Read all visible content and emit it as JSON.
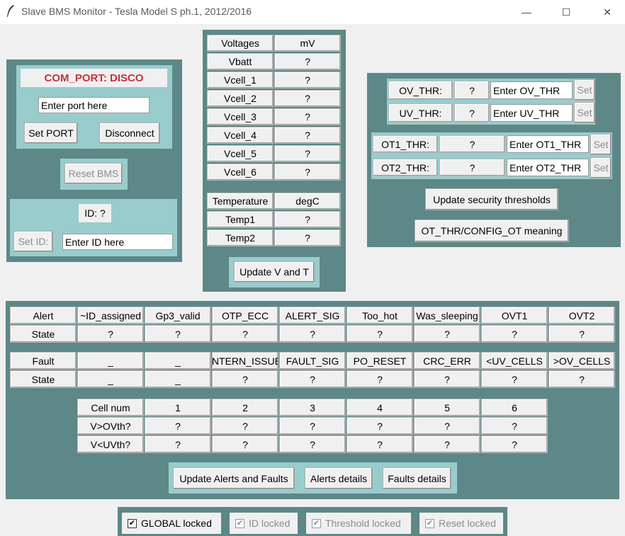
{
  "window": {
    "title": "Slave BMS Monitor - Tesla Model S ph.1, 2012/2016",
    "minimize": "—",
    "maximize": "☐",
    "close": "✕"
  },
  "port_panel": {
    "com_port_label": "COM_PORT: DISCO",
    "port_entry": "Enter port here",
    "set_port": "Set PORT",
    "disconnect": "Disconnect",
    "reset_bms": "Reset BMS",
    "id_label": "ID: ?",
    "set_id": "Set ID:",
    "id_entry": "Enter ID here"
  },
  "voltages": {
    "header": [
      "Voltages",
      "mV"
    ],
    "rows": [
      {
        "name": "Vbatt",
        "value": "?"
      },
      {
        "name": "Vcell_1",
        "value": "?"
      },
      {
        "name": "Vcell_2",
        "value": "?"
      },
      {
        "name": "Vcell_3",
        "value": "?"
      },
      {
        "name": "Vcell_4",
        "value": "?"
      },
      {
        "name": "Vcell_5",
        "value": "?"
      },
      {
        "name": "Vcell_6",
        "value": "?"
      }
    ],
    "temp_header": [
      "Temperature",
      "degC"
    ],
    "temp_rows": [
      {
        "name": "Temp1",
        "value": "?"
      },
      {
        "name": "Temp2",
        "value": "?"
      }
    ],
    "update_button": "Update V and T"
  },
  "thresholds": {
    "ov_label": "OV_THR:",
    "ov_value": "?",
    "ov_entry": "Enter OV_THR",
    "uv_label": "UV_THR:",
    "uv_value": "?",
    "uv_entry": "Enter UV_THR",
    "ot1_label": "OT1_THR:",
    "ot1_value": "?",
    "ot1_entry": "Enter OT1_THR",
    "ot2_label": "OT2_THR:",
    "ot2_value": "?",
    "ot2_entry": "Enter OT2_THR",
    "set": "Set",
    "update_button": "Update security thresholds",
    "meaning_button": "OT_THR/CONFIG_OT meaning"
  },
  "alerts": {
    "alert_header": [
      "Alert",
      "~ID_assigned",
      "Gp3_valid",
      "OTP_ECC",
      "ALERT_SIG",
      "Too_hot",
      "Was_sleeping",
      "OVT1",
      "OVT2"
    ],
    "alert_state": [
      "State",
      "?",
      "?",
      "?",
      "?",
      "?",
      "?",
      "?",
      "?"
    ],
    "fault_header": [
      "Fault",
      "_",
      "_",
      "INTERN_ISSUE",
      "FAULT_SIG",
      "PO_RESET",
      "CRC_ERR",
      "<UV_CELLS",
      ">OV_CELLS"
    ],
    "fault_state": [
      "State",
      "_",
      "_",
      "?",
      "?",
      "?",
      "?",
      "?",
      "?"
    ],
    "cell_header": [
      "Cell num",
      "1",
      "2",
      "3",
      "4",
      "5",
      "6"
    ],
    "ov_row": [
      "V>OVth?",
      "?",
      "?",
      "?",
      "?",
      "?",
      "?"
    ],
    "uv_row": [
      "V<UVth?",
      "?",
      "?",
      "?",
      "?",
      "?",
      "?"
    ],
    "update_button": "Update Alerts and Faults",
    "alerts_details": "Alerts details",
    "faults_details": "Faults details"
  },
  "locks": {
    "global": "GLOBAL locked",
    "id": "ID locked",
    "threshold": "Threshold locked",
    "reset": "Reset locked",
    "check": "✔"
  }
}
